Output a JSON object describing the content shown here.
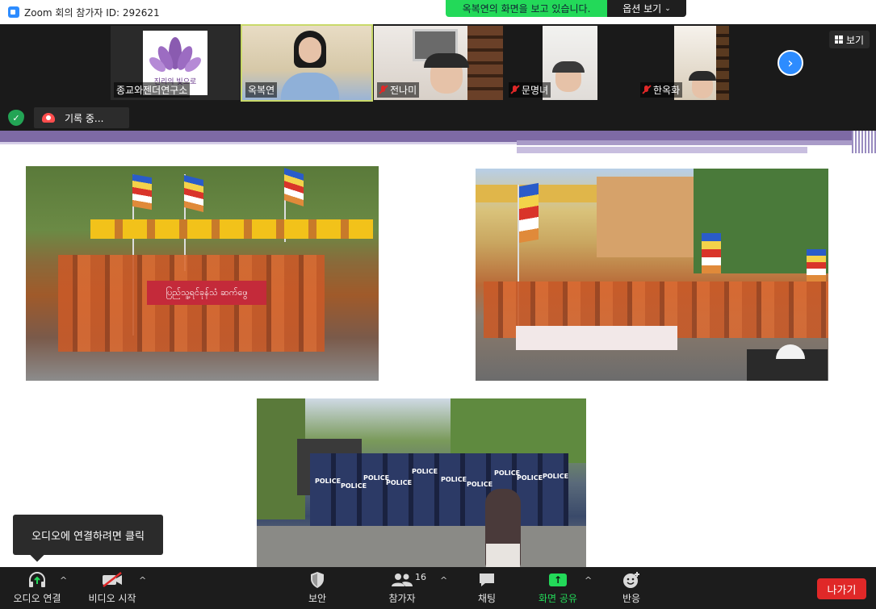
{
  "window": {
    "title": "Zoom 회의 참가자 ID: 292621"
  },
  "share_banner": {
    "text": "옥복연의 화면을 보고 있습니다.",
    "options_label": "옵션 보기"
  },
  "gallery": {
    "tiles": [
      {
        "name": "종교와젠더연구소",
        "logo_text": "진리의 빛으로",
        "muted": false
      },
      {
        "name": "옥복연",
        "muted": false,
        "active": true
      },
      {
        "name": "전나미",
        "muted": true
      },
      {
        "name": "문명녀",
        "muted": true
      },
      {
        "name": "한옥화",
        "muted": true
      }
    ],
    "view_label": "보기"
  },
  "recording": {
    "label": "기록 중..."
  },
  "slide": {
    "banner_text": "ပြည်သူ့ရင်ခုန်သံ ဆက်ဖွေ",
    "police_labels": [
      "POLICE",
      "POLICE",
      "POLICE",
      "POLICE",
      "POLICE",
      "POLICE",
      "POLICE",
      "POLICE",
      "POLICE",
      "POLICE"
    ]
  },
  "tooltip": {
    "text": "오디오에 연결하려면 클릭"
  },
  "toolbar": {
    "audio": "오디오 연결",
    "video": "비디오 시작",
    "security": "보안",
    "participants": "참가자",
    "participants_count": "16",
    "chat": "채팅",
    "share": "화면 공유",
    "reactions": "반응",
    "leave": "나가기"
  },
  "colors": {
    "zoom_blue": "#2d8cff",
    "share_green": "#23d959",
    "leave_red": "#e02828"
  }
}
